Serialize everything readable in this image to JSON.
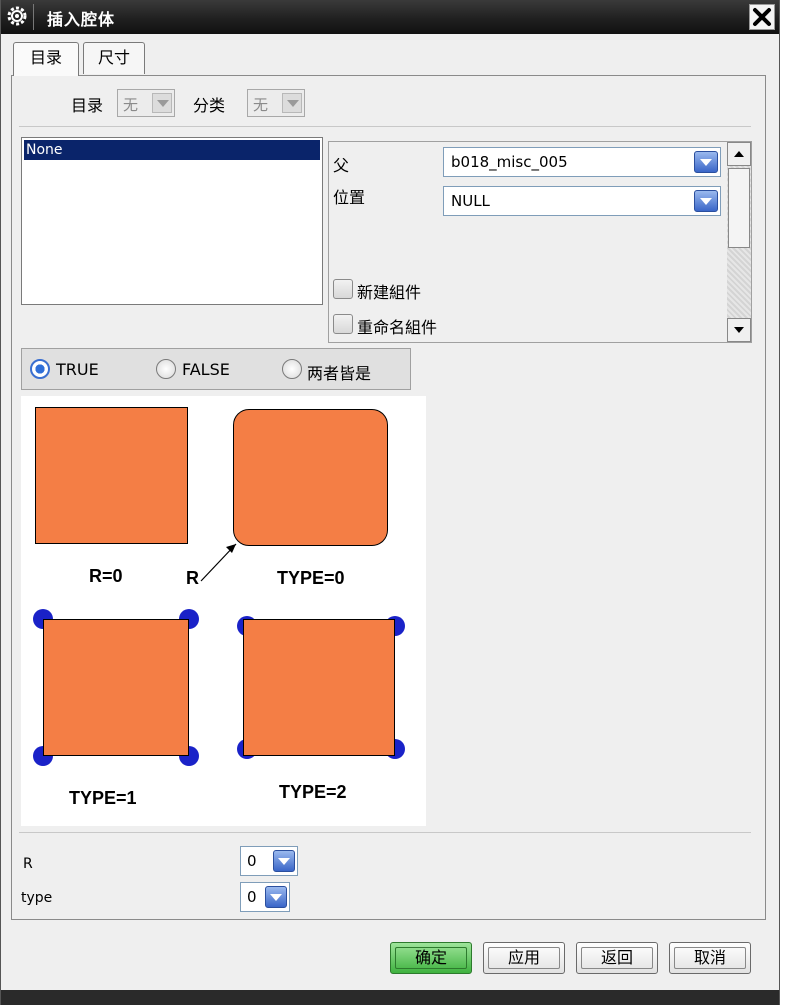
{
  "window": {
    "title": "插入腔体"
  },
  "tabs": [
    {
      "label": "目录",
      "active": true
    },
    {
      "label": "尺寸",
      "active": false
    }
  ],
  "catalog": {
    "catalog_label": "目录",
    "catalog_value": "无",
    "class_label": "分类",
    "class_value": "无"
  },
  "list": {
    "items": [
      "None"
    ],
    "selected": "None"
  },
  "props": {
    "parent_label": "父",
    "parent_value": "b018_misc_005",
    "position_label": "位置",
    "position_value": "NULL",
    "new_component_label": "新建組件",
    "rename_component_label": "重命名組件"
  },
  "radio": {
    "options": [
      "TRUE",
      "FALSE",
      "两者皆是"
    ],
    "selected": "TRUE"
  },
  "figure": {
    "cap_r0": "R=0",
    "cap_r": "R",
    "cap_type0": "TYPE=0",
    "cap_type1": "TYPE=1",
    "cap_type2": "TYPE=2"
  },
  "params": {
    "r_label": "R",
    "r_value": "0",
    "type_label": "type",
    "type_value": "0"
  },
  "buttons": {
    "ok": "确定",
    "apply": "应用",
    "back": "返回",
    "cancel": "取消"
  },
  "colors": {
    "shape_fill": "#f47e45",
    "dot": "#1a22c8",
    "selection": "#0a246a",
    "ok_button": "#3fb23f"
  }
}
